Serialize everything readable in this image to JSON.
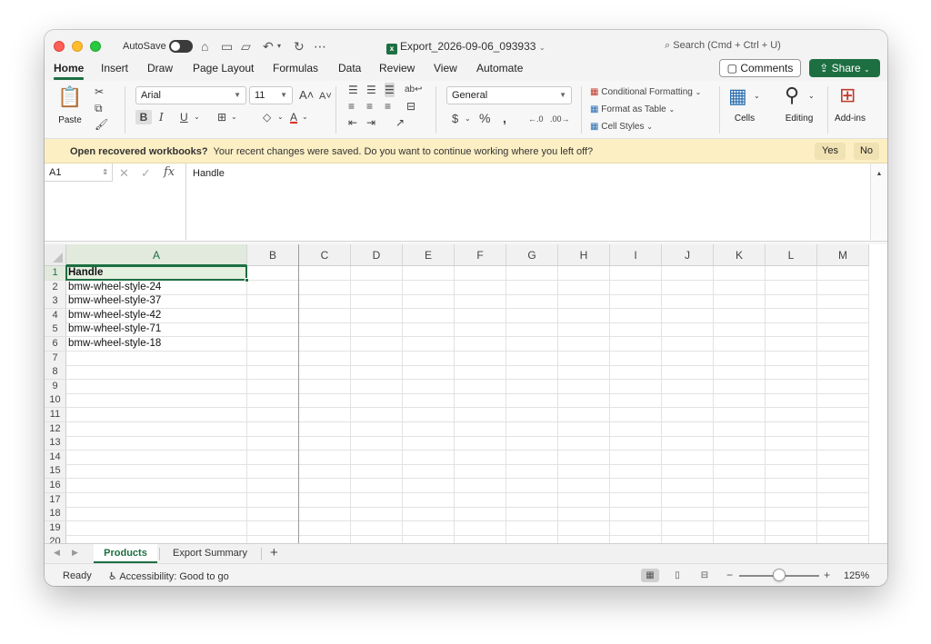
{
  "titlebar": {
    "autosave_label": "AutoSave",
    "document_title": "Export_2026-09-06_093933",
    "search_placeholder": "Search (Cmd + Ctrl + U)"
  },
  "menu": {
    "tabs": [
      "Home",
      "Insert",
      "Draw",
      "Page Layout",
      "Formulas",
      "Data",
      "Review",
      "View",
      "Automate"
    ],
    "active_tab": "Home",
    "comments_label": "Comments",
    "share_label": "Share"
  },
  "ribbon": {
    "paste_label": "Paste",
    "font_name": "Arial",
    "font_size": "11",
    "number_format": "General",
    "conditional_formatting": "Conditional Formatting",
    "format_as_table": "Format as Table",
    "cell_styles": "Cell Styles",
    "cells_label": "Cells",
    "editing_label": "Editing",
    "addins_label": "Add-ins"
  },
  "infobar": {
    "bold_text": "Open recovered workbooks?",
    "message": "Your recent changes were saved. Do you want to continue working where you left off?",
    "yes_label": "Yes",
    "no_label": "No"
  },
  "formula_bar": {
    "name_box": "A1",
    "fx_label": "fx",
    "formula": "Handle"
  },
  "grid": {
    "columns": [
      "A",
      "B",
      "C",
      "D",
      "E",
      "F",
      "G",
      "H",
      "I",
      "J",
      "K",
      "L",
      "M"
    ],
    "selected_column": "A",
    "selected_row": 1,
    "rows": [
      [
        "Handle"
      ],
      [
        "bmw-wheel-style-24"
      ],
      [
        "bmw-wheel-style-37"
      ],
      [
        "bmw-wheel-style-42"
      ],
      [
        "bmw-wheel-style-71"
      ],
      [
        "bmw-wheel-style-18"
      ],
      [
        ""
      ],
      [
        ""
      ],
      [
        ""
      ],
      [
        ""
      ],
      [
        ""
      ],
      [
        ""
      ],
      [
        ""
      ],
      [
        ""
      ],
      [
        ""
      ],
      [
        ""
      ],
      [
        ""
      ],
      [
        ""
      ],
      [
        ""
      ],
      [
        ""
      ]
    ]
  },
  "sheets": {
    "tabs": [
      "Products",
      "Export Summary"
    ],
    "active": "Products",
    "add_label": "+"
  },
  "status": {
    "ready": "Ready",
    "accessibility": "Accessibility: Good to go",
    "zoom": "125%",
    "zoom_minus": "−",
    "zoom_plus": "+",
    "zoom_fraction": 0.5
  }
}
